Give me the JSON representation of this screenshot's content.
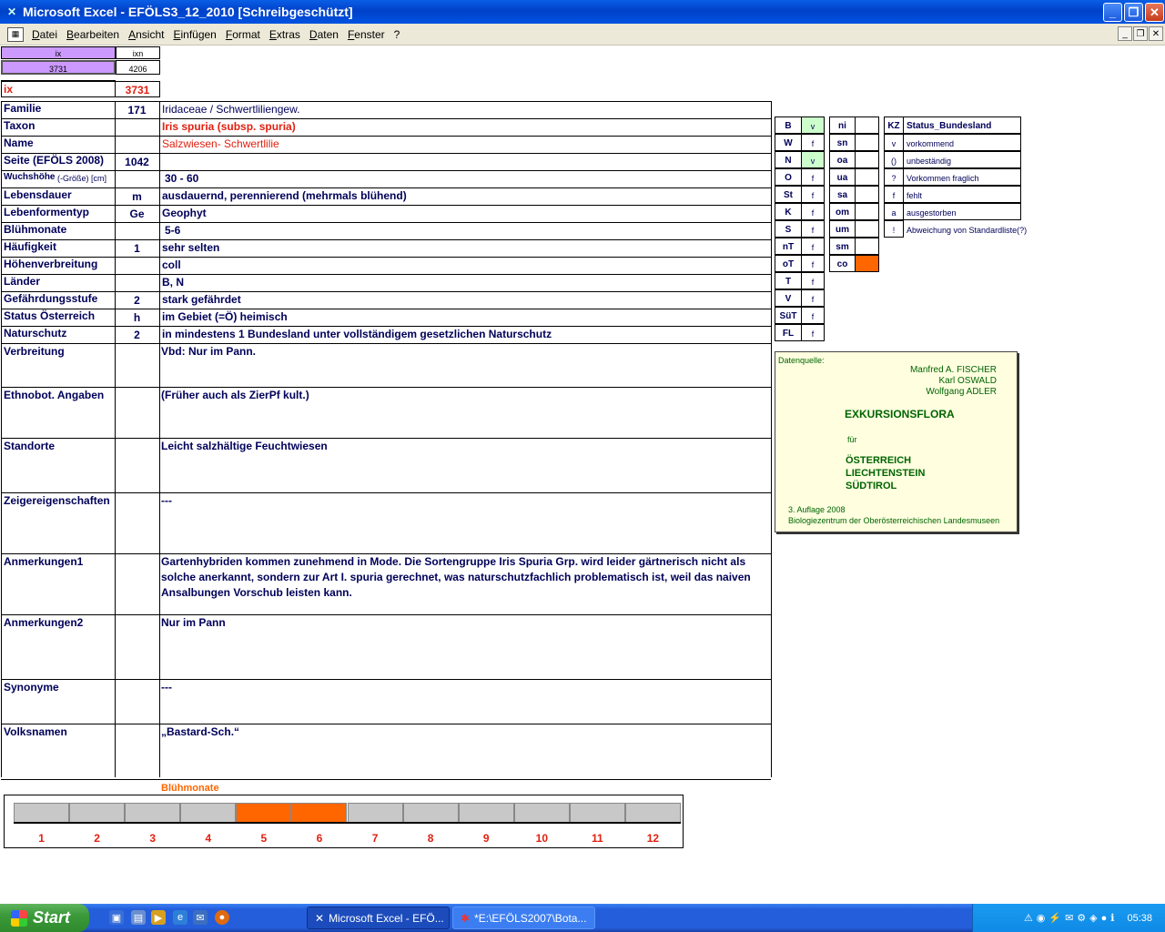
{
  "window": {
    "title": "Microsoft Excel - EFÖLS3_12_2010  [Schreibgeschützt]"
  },
  "menu": [
    "Datei",
    "Bearbeiten",
    "Ansicht",
    "Einfügen",
    "Format",
    "Extras",
    "Daten",
    "Fenster",
    "?"
  ],
  "index": {
    "ix_header": "ix",
    "ixn_header": "ixn",
    "ix_value": "3731",
    "ixn_value": "4206",
    "ix_label": "ix",
    "ix_big": "3731"
  },
  "rows": [
    {
      "label": "Familie",
      "code": "171",
      "value": "Iridaceae  /  Schwertliliengew."
    },
    {
      "label": "Taxon",
      "code": "",
      "value": "Iris spuria (subsp. spuria)"
    },
    {
      "label": "Name",
      "code": "",
      "value": "Salzwiesen- Schwertlilie"
    },
    {
      "label": "Seite (EFÖLS 2008)",
      "code": "1042",
      "value": ""
    },
    {
      "label": "Wuchshöhe",
      "label_suffix": " (-Größe) [cm]",
      "code": "",
      "value": "30 - 60"
    },
    {
      "label": "Lebensdauer",
      "code": "m",
      "value": "ausdauernd, perennierend (mehrmals blühend)"
    },
    {
      "label": "Lebenformentyp",
      "code": "Ge",
      "value": "Geophyt"
    },
    {
      "label": "Blühmonate",
      "code": "",
      "value": "5-6"
    },
    {
      "label": "Häufigkeit",
      "code": "1",
      "value": "sehr selten"
    },
    {
      "label": "Höhenverbreitung",
      "code": "",
      "value": "coll"
    },
    {
      "label": "Länder",
      "code": "",
      "value": "B, N"
    },
    {
      "label": "Gefährdungsstufe",
      "code": "2",
      "value": "stark gefährdet"
    },
    {
      "label": "Status Österreich",
      "code": "h",
      "value": "im Gebiet (=Ö) heimisch"
    },
    {
      "label": "Naturschutz",
      "code": "2",
      "value": "in mindestens 1 Bundesland unter vollständigem gesetzlichen Naturschutz"
    }
  ],
  "tall_rows": [
    {
      "label": "Verbreitung",
      "lines": [
        "Vbd: Nur im Pann."
      ]
    },
    {
      "label": "Ethnobot. Angaben",
      "lines": [
        "(Früher auch als ZierPf kult.)"
      ]
    },
    {
      "label": "Standorte",
      "lines": [
        "Leicht salzhältige Feuchtwiesen"
      ]
    },
    {
      "label": "Zeigereigenschaften",
      "lines": [
        "---"
      ]
    },
    {
      "label": "Anmerkungen1",
      "lines": [
        "Gartenhybriden kommen zunehmend in Mode. Die Sortengruppe Iris Spuria Grp. wird leider gärtnerisch nicht als",
        "solche anerkannt, sondern zur Art I. spuria gerechnet, was naturschutzfachlich problematisch ist, weil das naiven",
        "Ansalbungen Vorschub leisten kann."
      ]
    },
    {
      "label": "Anmerkungen2",
      "lines": [
        "Nur im Pann"
      ]
    },
    {
      "label": "Synonyme",
      "lines": [
        "---"
      ]
    },
    {
      "label": "Volksnamen",
      "lines": [
        "„Bastard-Sch.“"
      ]
    }
  ],
  "states1": [
    {
      "k": "B",
      "v": "v",
      "on": true
    },
    {
      "k": "W",
      "v": "f",
      "on": false
    },
    {
      "k": "N",
      "v": "v",
      "on": true
    },
    {
      "k": "O",
      "v": "f",
      "on": false
    },
    {
      "k": "St",
      "v": "f",
      "on": false
    },
    {
      "k": "K",
      "v": "f",
      "on": false
    },
    {
      "k": "S",
      "v": "f",
      "on": false
    },
    {
      "k": "nT",
      "v": "f",
      "on": false
    },
    {
      "k": "oT",
      "v": "f",
      "on": false
    },
    {
      "k": "T",
      "v": "f",
      "on": false
    },
    {
      "k": "V",
      "v": "f",
      "on": false
    },
    {
      "k": "SüT",
      "v": "f",
      "on": false
    },
    {
      "k": "FL",
      "v": "f",
      "on": false
    }
  ],
  "states2": [
    {
      "k": "ni",
      "on": false
    },
    {
      "k": "sn",
      "on": false
    },
    {
      "k": "oa",
      "on": false
    },
    {
      "k": "ua",
      "on": false
    },
    {
      "k": "sa",
      "on": false
    },
    {
      "k": "om",
      "on": false
    },
    {
      "k": "um",
      "on": false
    },
    {
      "k": "sm",
      "on": false
    },
    {
      "k": "co",
      "on": true
    }
  ],
  "legend": {
    "header_kz": "KZ",
    "header_status": "Status_Bundesland",
    "items": [
      {
        "kz": "v",
        "text": "vorkommend"
      },
      {
        "kz": "()",
        "text": "unbeständig"
      },
      {
        "kz": "?",
        "text": "Vorkommen fraglich"
      },
      {
        "kz": "f",
        "text": "fehlt"
      },
      {
        "kz": "a",
        "text": "ausgestorben"
      },
      {
        "kz": "!",
        "text": "Abweichung von Standardliste(?)"
      }
    ]
  },
  "source": {
    "heading": "Datenquelle:",
    "authors": [
      "Manfred A. FISCHER",
      "Karl OSWALD",
      "Wolfgang ADLER"
    ],
    "title": "EXKURSIONSFLORA",
    "fuer": "für",
    "countries": [
      "ÖSTERREICH",
      "LIECHTENSTEIN",
      "SÜDTIROL"
    ],
    "edition": "3. Auflage 2008",
    "publisher": "Biologiezentrum der Oberösterreichischen Landesmuseen"
  },
  "bloom": {
    "title": "Blühmonate",
    "months": [
      "1",
      "2",
      "3",
      "4",
      "5",
      "6",
      "7",
      "8",
      "9",
      "10",
      "11",
      "12"
    ],
    "active": [
      5,
      6
    ],
    "colors": {
      "active": "#ff6600",
      "inactive": "#c8c8c8"
    }
  },
  "colors": {
    "green_on": "#ccffcc",
    "orange": "#ff6600",
    "lavender": "#cc99ff",
    "legend_bg": "#ffffe0"
  },
  "taskbar": {
    "start": "Start",
    "tasks": [
      "Microsoft Excel - EFÖ...",
      "*E:\\EFÖLS2007\\Bota..."
    ],
    "clock": "05:38"
  }
}
